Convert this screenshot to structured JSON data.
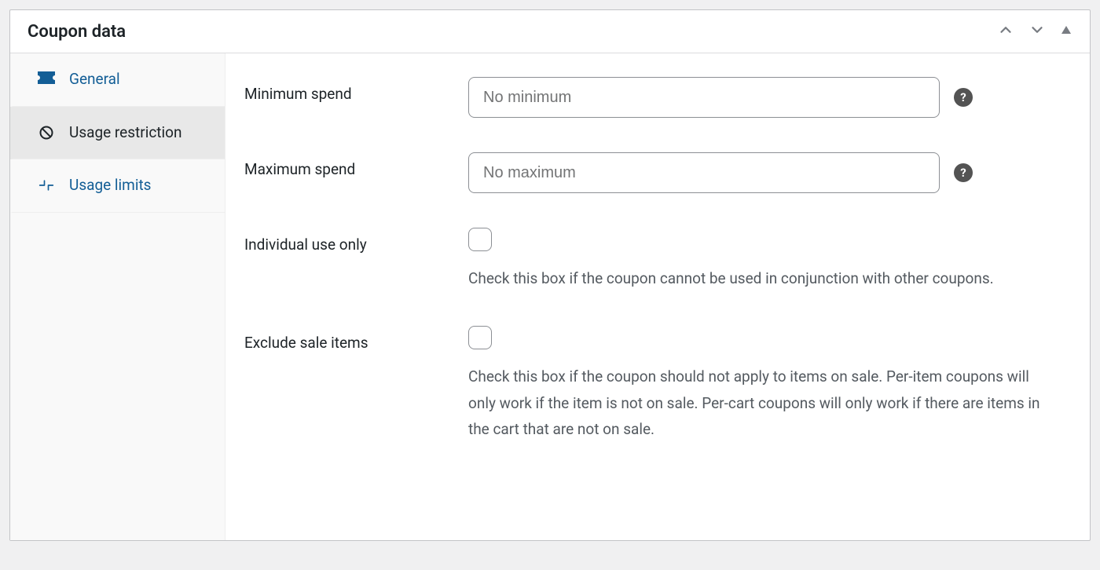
{
  "panel": {
    "title": "Coupon data"
  },
  "tabs": [
    {
      "label": "General"
    },
    {
      "label": "Usage restriction"
    },
    {
      "label": "Usage limits"
    }
  ],
  "fields": {
    "minimum_spend": {
      "label": "Minimum spend",
      "placeholder": "No minimum",
      "value": ""
    },
    "maximum_spend": {
      "label": "Maximum spend",
      "placeholder": "No maximum",
      "value": ""
    },
    "individual_use": {
      "label": "Individual use only",
      "help": "Check this box if the coupon cannot be used in conjunction with other coupons."
    },
    "exclude_sale": {
      "label": "Exclude sale items",
      "help": "Check this box if the coupon should not apply to items on sale. Per-item coupons will only work if the item is not on sale. Per-cart coupons will only work if there are items in the cart that are not on sale."
    }
  }
}
